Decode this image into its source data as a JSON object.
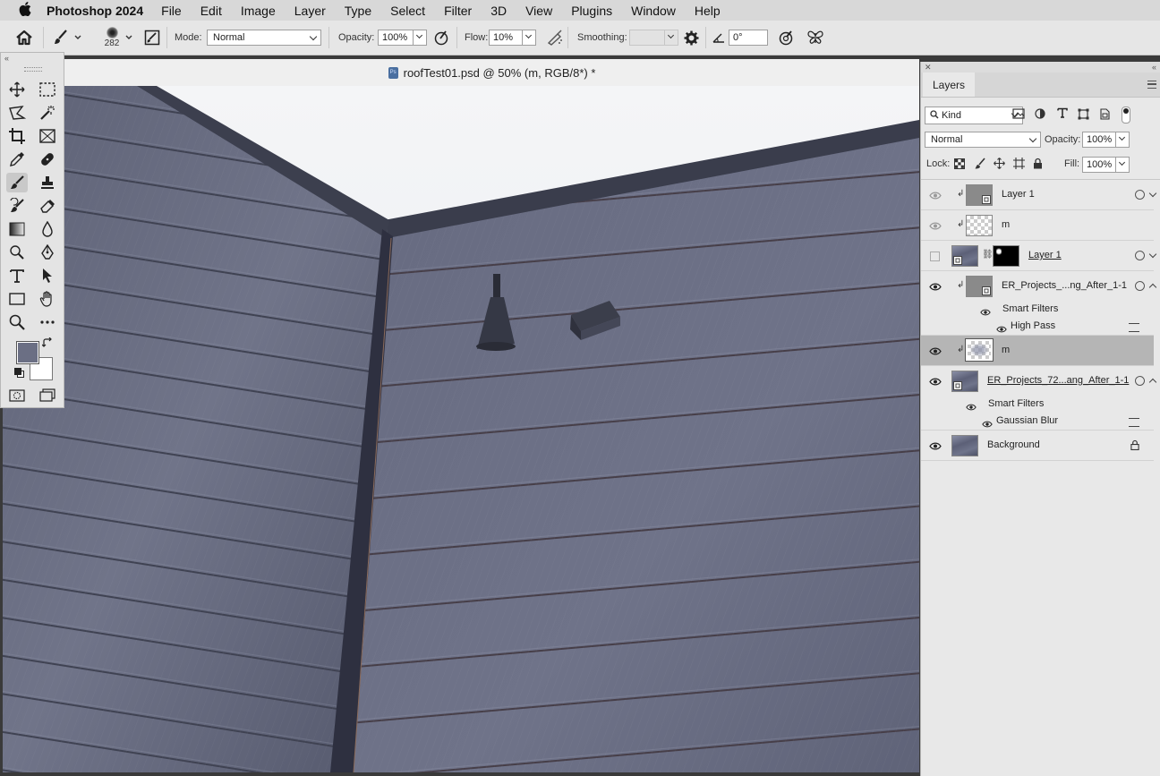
{
  "menubar": {
    "app_name": "Photoshop 2024",
    "items": [
      "File",
      "Edit",
      "Image",
      "Layer",
      "Type",
      "Select",
      "Filter",
      "3D",
      "View",
      "Plugins",
      "Window",
      "Help"
    ]
  },
  "options": {
    "brush_size": "282",
    "mode_label": "Mode:",
    "mode_value": "Normal",
    "opacity_label": "Opacity:",
    "opacity_value": "100%",
    "flow_label": "Flow:",
    "flow_value": "10%",
    "smoothing_label": "Smoothing:",
    "smoothing_value": "",
    "angle_value": "0°"
  },
  "document": {
    "title": "roofTest01.psd @ 50% (m, RGB/8*) *",
    "ps_badge": "Ps"
  },
  "tools": {
    "foreground_color": "#6b6f84",
    "background_color": "#ffffff"
  },
  "layers_panel": {
    "tab": "Layers",
    "filter_kind": "Kind",
    "blend_mode": "Normal",
    "opacity_label": "Opacity:",
    "opacity_value": "100%",
    "lock_label": "Lock:",
    "fill_label": "Fill:",
    "fill_value": "100%",
    "layers": [
      {
        "name": "Layer 1",
        "visible": true
      },
      {
        "name": "m",
        "visible": true
      },
      {
        "name": "Layer 1",
        "visible": false
      },
      {
        "name": "ER_Projects_...ng_After_1-1",
        "visible": true,
        "filters_label": "Smart Filters",
        "filter": "High Pass"
      },
      {
        "name": "m",
        "visible": true,
        "selected": true
      },
      {
        "name": "ER_Projects_72...ang_After_1-1",
        "visible": true,
        "filters_label": "Smart Filters",
        "filter": "Gaussian Blur"
      },
      {
        "name": "Background",
        "visible": true
      }
    ]
  }
}
